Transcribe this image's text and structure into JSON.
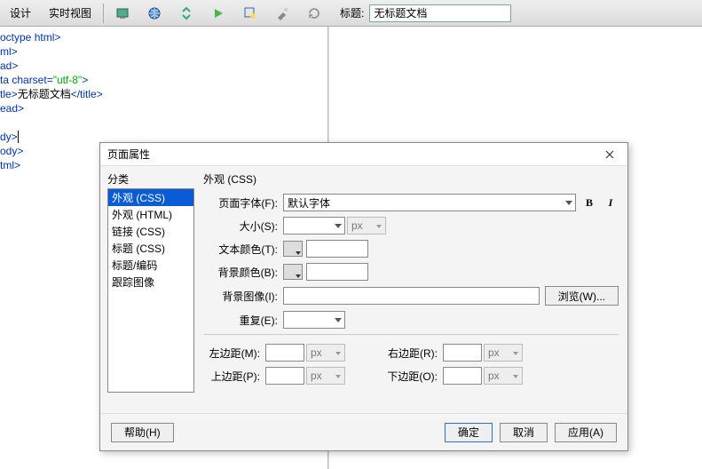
{
  "toolbar": {
    "design": "设计",
    "live": "实时视图",
    "title_label": "标题:",
    "title_value": "无标题文档"
  },
  "code": {
    "l1": "octype html>",
    "l2": "ml>",
    "l3": "ad>",
    "l4a": "ta charset=",
    "l4b": "\"utf-8\"",
    "l4c": ">",
    "l5a": "tle>",
    "l5b": "无标题文档",
    "l5c": "</title>",
    "l6": "ead>",
    "l7": "dy>",
    "l8": "ody>",
    "l9": "tml>"
  },
  "dialog": {
    "title": "页面属性",
    "cat_label": "分类",
    "categories": [
      "外观 (CSS)",
      "外观 (HTML)",
      "链接 (CSS)",
      "标题 (CSS)",
      "标题/编码",
      "跟踪图像"
    ],
    "panel_title": "外观 (CSS)",
    "font_label": "页面字体(F):",
    "font_value": "默认字体",
    "size_label": "大小(S):",
    "size_unit": "px",
    "textcolor_label": "文本颜色(T):",
    "bgcolor_label": "背景颜色(B):",
    "bgimage_label": "背景图像(I):",
    "browse": "浏览(W)...",
    "repeat_label": "重复(E):",
    "margin_left": "左边距(M):",
    "margin_right": "右边距(R):",
    "margin_top": "上边距(P):",
    "margin_bottom": "下边距(O):",
    "unit_px": "px",
    "help": "帮助(H)",
    "ok": "确定",
    "cancel": "取消",
    "apply": "应用(A)",
    "bold": "B",
    "italic": "I"
  }
}
